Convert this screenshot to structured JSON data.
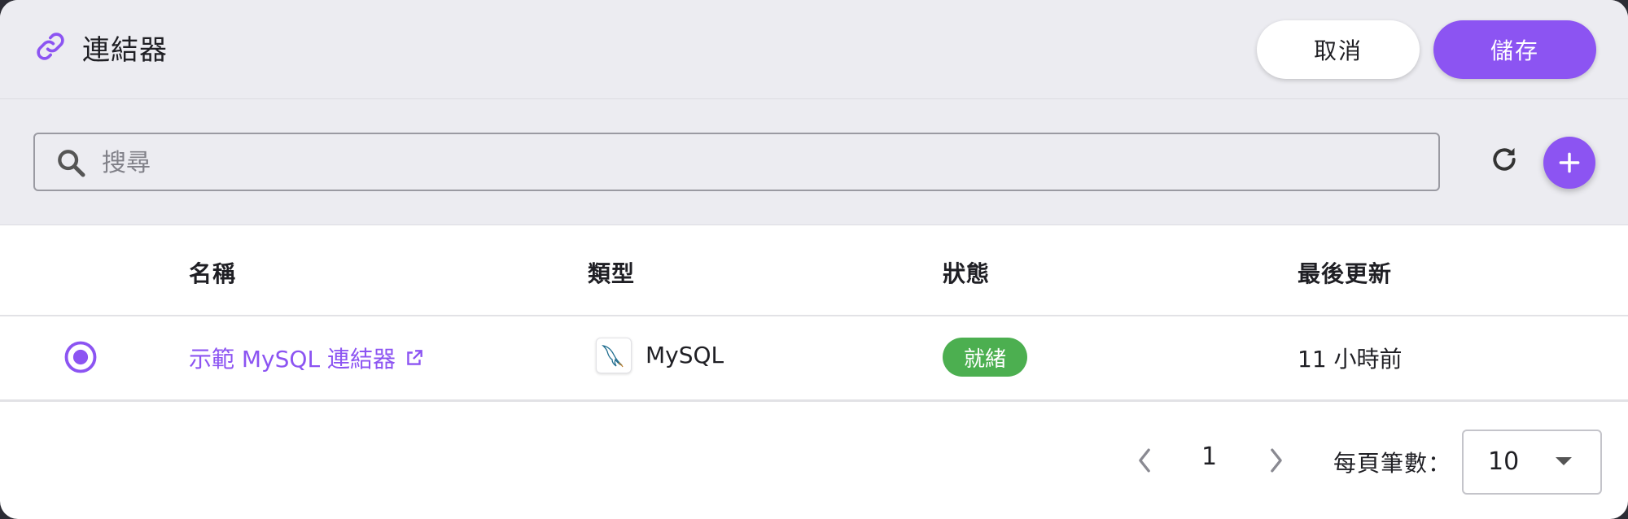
{
  "header": {
    "title": "連結器",
    "cancel_label": "取消",
    "save_label": "儲存",
    "accent_color": "#8c54f2"
  },
  "search": {
    "placeholder": "搜尋"
  },
  "table": {
    "columns": [
      "名稱",
      "類型",
      "狀態",
      "最後更新"
    ],
    "rows": [
      {
        "selected": true,
        "name": "示範 MySQL 連結器",
        "type": "MySQL",
        "type_icon": "mysql-dolphin-icon",
        "status": "就緒",
        "status_color": "#4caf50",
        "updated": "11 小時前"
      }
    ]
  },
  "pagination": {
    "page": "1",
    "per_page_label": "每頁筆數：",
    "per_page_value": "10"
  }
}
